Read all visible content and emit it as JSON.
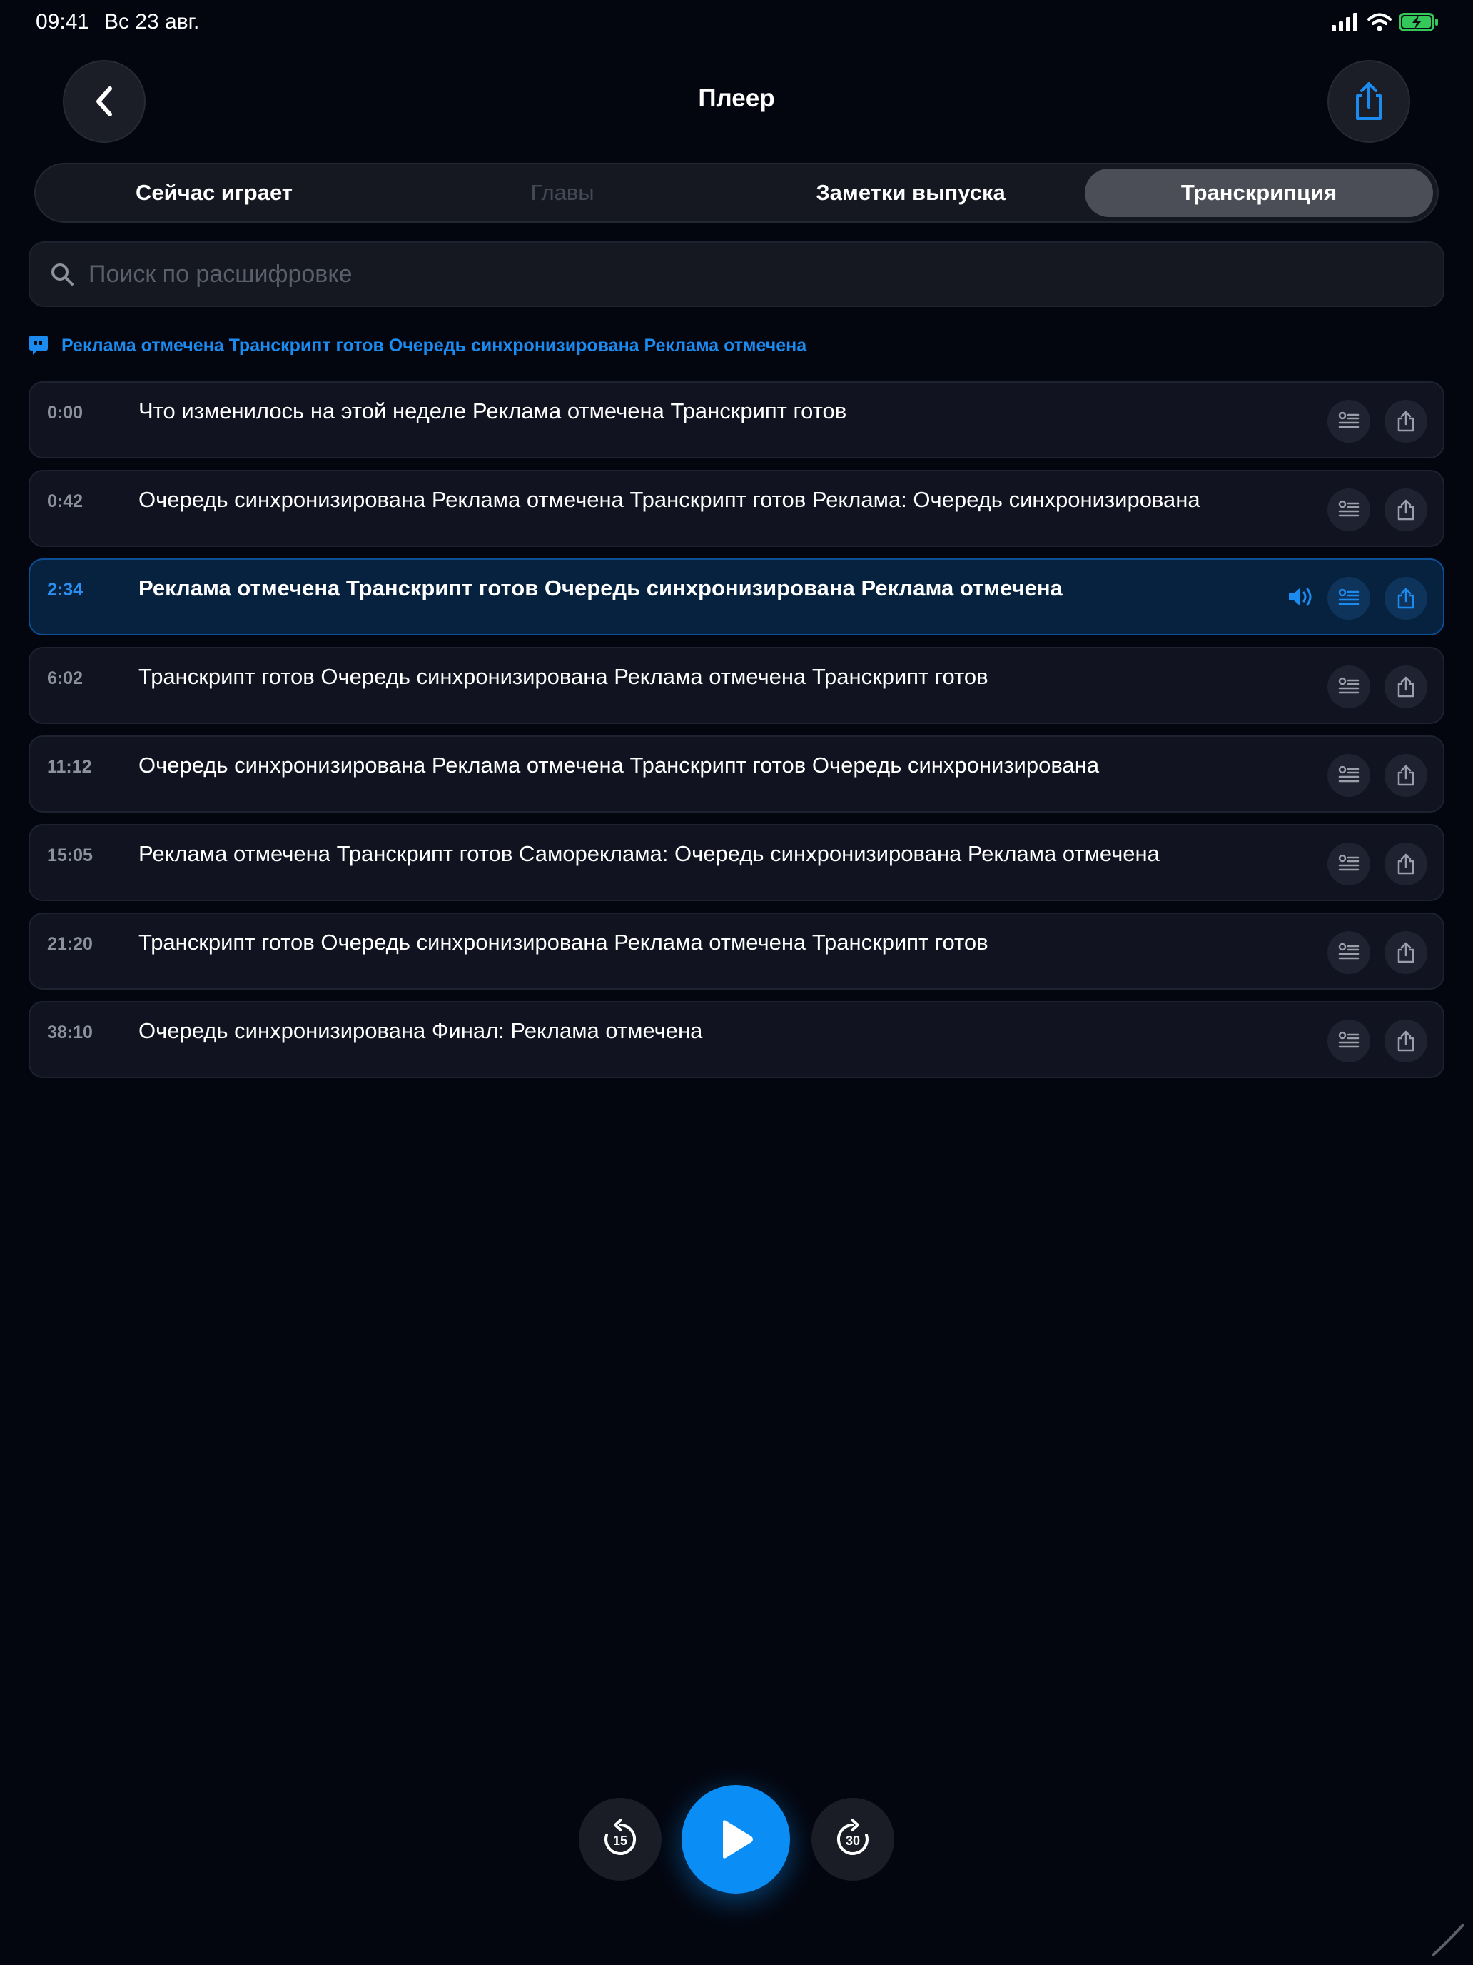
{
  "status_bar": {
    "time": "09:41",
    "date": "Вс 23 авг."
  },
  "header": {
    "title": "Плеер"
  },
  "tabs": [
    {
      "label": "Сейчас играет",
      "state": "normal"
    },
    {
      "label": "Главы",
      "state": "disabled"
    },
    {
      "label": "Заметки выпуска",
      "state": "normal"
    },
    {
      "label": "Транскрипция",
      "state": "selected"
    }
  ],
  "search": {
    "placeholder": "Поиск по расшифровке",
    "value": ""
  },
  "now_playing_caption": "Реклама отмечена Транскрипт готов Очередь синхронизирована Реклама отмечена",
  "segments": [
    {
      "time": "0:00",
      "text": "Что изменилось на этой неделе Реклама отмечена Транскрипт готов"
    },
    {
      "time": "0:42",
      "text": "Очередь синхронизирована Реклама отмечена Транскрипт готов Реклама: Очередь синхронизирована"
    },
    {
      "time": "2:34",
      "text": "Реклама отмечена Транскрипт готов Очередь синхронизирована Реклама отмечена",
      "playing": true
    },
    {
      "time": "6:02",
      "text": "Транскрипт готов Очередь синхронизирована Реклама отмечена Транскрипт готов"
    },
    {
      "time": "11:12",
      "text": "Очередь синхронизирована Реклама отмечена Транскрипт готов Очередь синхронизирована"
    },
    {
      "time": "15:05",
      "text": "Реклама отмечена Транскрипт готов Самореклама: Очередь синхронизирована Реклама отмечена"
    },
    {
      "time": "21:20",
      "text": "Транскрипт готов Очередь синхронизирована Реклама отмечена Транскрипт готов"
    },
    {
      "time": "38:10",
      "text": "Очередь синхронизирована Финал: Реклама отмечена"
    }
  ],
  "controls": {
    "skip_back": "15",
    "skip_forward": "30"
  },
  "colors": {
    "accent": "#0a8ef5",
    "background": "#04060f",
    "active_row": "#06223f"
  }
}
